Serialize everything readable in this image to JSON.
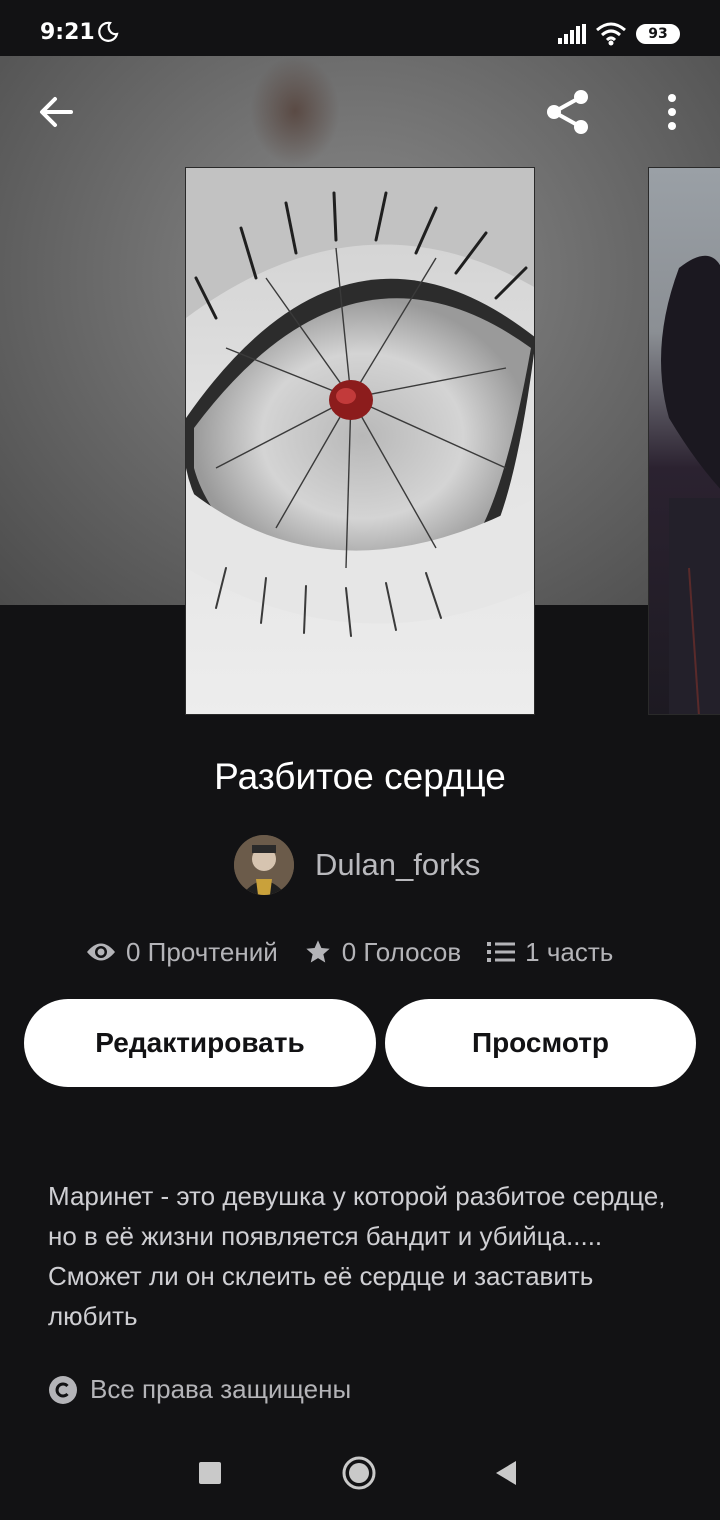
{
  "status_bar": {
    "time": "9:21",
    "battery": "93",
    "icons": [
      "moon-icon",
      "signal-icon",
      "wifi-icon",
      "battery-icon"
    ]
  },
  "toolbar": {
    "icons": [
      "back-arrow-icon",
      "share-icon",
      "more-vertical-icon"
    ]
  },
  "story": {
    "title": "Разбитое сердце",
    "author": "Dulan_forks",
    "stats": {
      "reads": "0 Прочтений",
      "votes": "0 Голосов",
      "parts": "1 часть"
    },
    "description": "Маринет - это девушка у которой разбитое сердце, но в её жизни появляется бандит и убийца..... Сможет ли он склеить её сердце и заставить любить",
    "copyright": "Все права защищены"
  },
  "actions": {
    "edit_label": "Редактировать",
    "view_label": "Просмотр"
  },
  "colors": {
    "background": "#121214",
    "button_bg": "#ffffff",
    "muted_text": "#b4b4b8"
  }
}
